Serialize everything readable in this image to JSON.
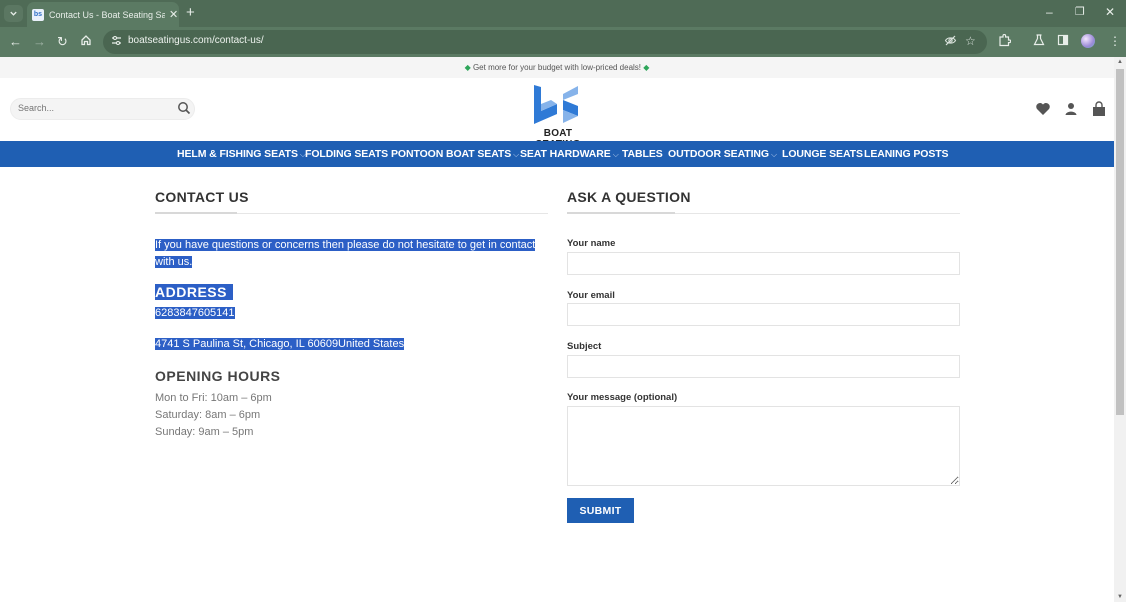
{
  "browser": {
    "tab_title": "Contact Us - Boat Seating Sale",
    "tab_favicon_text": "bs",
    "url": "boatseatingus.com/contact-us/",
    "icons": {
      "tab_menu": "chevron-down",
      "new_tab": "+",
      "minimize": "–",
      "restore": "❐",
      "close": "✕",
      "back": "←",
      "forward": "→",
      "reload": "↻",
      "home": "⌂",
      "site_settings": "⚙",
      "eye_off": "eye-off",
      "bookmark": "☆",
      "extensions": "puzzle",
      "labs": "flask",
      "side_panel": "side-panel",
      "menu": "⋮"
    }
  },
  "site": {
    "promo": {
      "text": "Get more for your budget with low-priced deals!",
      "icon": "◆"
    },
    "search": {
      "placeholder": "Search..."
    },
    "logo": {
      "text": "BOAT SEATING"
    },
    "nav": [
      {
        "label": "HELM & FISHING SEATS",
        "has_dropdown": true
      },
      {
        "label": "FOLDING SEATS",
        "has_dropdown": false
      },
      {
        "label": "PONTOON BOAT SEATS",
        "has_dropdown": true
      },
      {
        "label": "SEAT HARDWARE",
        "has_dropdown": true
      },
      {
        "label": "TABLES",
        "has_dropdown": false
      },
      {
        "label": "OUTDOOR SEATING",
        "has_dropdown": true
      },
      {
        "label": "LOUNGE SEATS",
        "has_dropdown": false
      },
      {
        "label": "LEANING POSTS",
        "has_dropdown": false
      }
    ],
    "caret": "⌵",
    "brand_color": "#1f5fb3"
  },
  "contact": {
    "title": "CONTACT US",
    "intro": "If you have questions or concerns then please do not hesitate to get in contact with us.",
    "address_heading": "ADDRESS",
    "phone": "6283847605141",
    "address": "4741 S Paulina St, Chicago, IL 60609United States",
    "hours_heading": "OPENING HOURS",
    "hours": [
      "Mon to Fri: 10am – 6pm",
      "Saturday: 8am – 6pm",
      "Sunday: 9am – 5pm"
    ]
  },
  "form": {
    "title": "ASK A QUESTION",
    "fields": {
      "name": {
        "label": "Your name",
        "value": ""
      },
      "email": {
        "label": "Your email",
        "value": ""
      },
      "subject": {
        "label": "Subject",
        "value": ""
      },
      "message": {
        "label": "Your message (optional)",
        "value": ""
      }
    },
    "submit_label": "SUBMIT"
  }
}
